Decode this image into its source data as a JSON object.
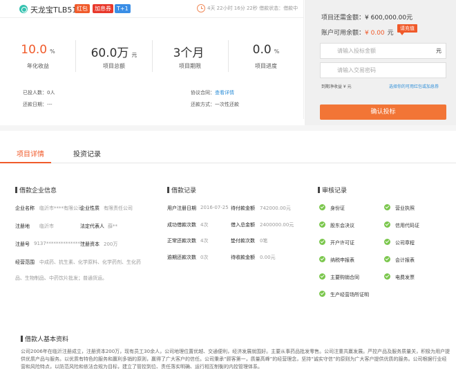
{
  "project": {
    "title": "天龙宝TLB510",
    "tags": [
      {
        "label": "红包",
        "color": "#f05a2a"
      },
      {
        "label": "加息券",
        "color": "#e8382b"
      },
      {
        "label": "T+1",
        "color": "#3a8ee6"
      }
    ],
    "countdown": "4天 22小时 16分 22秒 借款状态：借款中"
  },
  "stats": [
    {
      "value": "10.0",
      "unit": "%",
      "label": "年化收益",
      "color": "#f05a2a"
    },
    {
      "value": "60.0万",
      "unit": "元",
      "label": "项目总额",
      "color": "#333333"
    },
    {
      "value": "3个月",
      "unit": "",
      "label": "项目期限",
      "color": "#333333"
    },
    {
      "value": "0.0",
      "unit": "%",
      "label": "项目进度",
      "color": "#333333"
    }
  ],
  "info": {
    "invested": "已投人数：0人",
    "deadline": "还款日期：---",
    "agreement_label": "协议合同：",
    "agreement_link": "查看详情",
    "repay_method": "还款方式：一次性还款"
  },
  "invest_panel": {
    "remaining_label": "项目还需金额：",
    "remaining_value": "¥ 600,000.00元",
    "balance_label": "账户可用余额：",
    "balance_value": "¥ 0.00",
    "balance_unit": "元",
    "recharge_label": "请充值",
    "amount_placeholder": "请输入投标金额",
    "amount_unit": "元",
    "password_placeholder": "请输入交易密码",
    "expected_income": "到期净收益 ¥ 元",
    "coupon_link": "选择你的可用红包或加息券",
    "invest_button": "确认投标"
  },
  "tabs": [
    {
      "label": "项目详情",
      "active": true
    },
    {
      "label": "投资记录",
      "active": false
    }
  ],
  "company": {
    "title": "借款企业信息",
    "name_label": "企业名称",
    "name_value": "临沂市****有限公司",
    "nature_label": "企业性质",
    "nature_value": "有限责任公司",
    "reg_place_label": "注册地",
    "reg_place_value": "临沂市",
    "legal_label": "法定代表人",
    "legal_value": "薛**",
    "reg_no_label": "注册号",
    "reg_no_value": "9137****************",
    "capital_label": "注册资本",
    "capital_value": "200万",
    "scope_label": "经营范围",
    "scope_line1": "中成药、抗生素、化学原料、化学药剂、生化药",
    "scope_line2": "品、生物制品、中药饮片批发；普通货运。"
  },
  "loan_record": {
    "title": "借款记录",
    "rows": [
      {
        "k1": "用户注册日期",
        "v1": "2016-07-25",
        "k2": "待付款金额",
        "v2": "742000.00元"
      },
      {
        "k1": "成功借款次数",
        "v1": "4次",
        "k2": "借入总金额",
        "v2": "2400000.00元"
      },
      {
        "k1": "正常还款次数",
        "v1": "4次",
        "k2": "垫付款次数",
        "v2": "0笔"
      },
      {
        "k1": "逾期还款次数",
        "v1": "0次",
        "k2": "待收款金额",
        "v2": "0.00元"
      }
    ]
  },
  "review": {
    "title": "审核记录",
    "items": [
      "身份证",
      "营业执照",
      "股东会决议",
      "信用代码证",
      "开户许可证",
      "公司章程",
      "纳税申报表",
      "会计报表",
      "主要购销合同",
      "电费发票",
      "生产经营场所证明"
    ]
  },
  "borrower": {
    "title": "借款人基本资料",
    "description": "公司2006年在临沂注册成立，注册资本200万，现有员工30余人，公司地理位置优越、交通便利，经济发展就围好。主要从事药品批发零售。公司注重共赢发展。严控产品及服务质量关，积极为用户提供优质产品与服务。以优质有特色的服务和赢利多销的原则，赢得了广大客户的信任。公司秉承“顾客第一，质量高峰”的经营理念，坚持“诚实守信”的原则为广大客户提供优质的服务。公司根据行业经营和风险特点，以防范风险和依法合规为目标，建立了管控到位、责任落实明确、运行相互制衡的内控管理体系。"
  }
}
